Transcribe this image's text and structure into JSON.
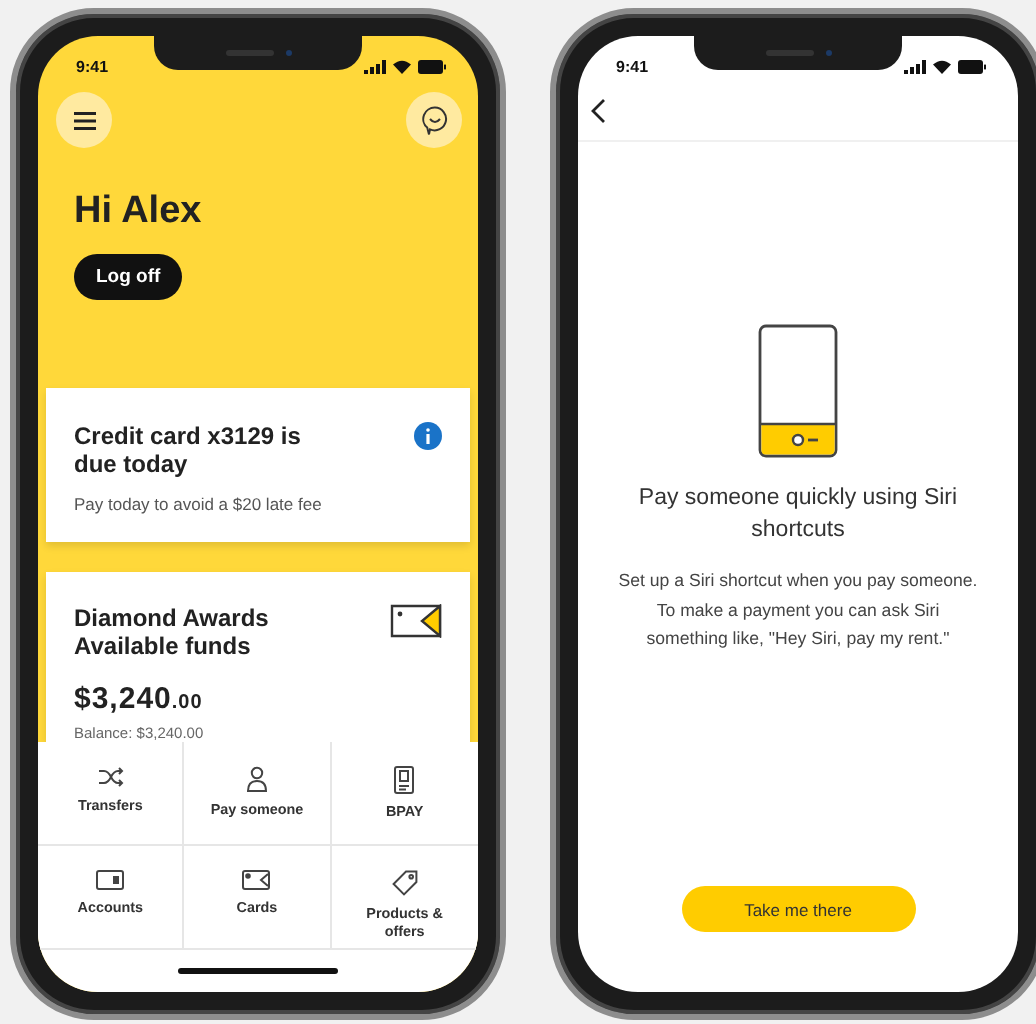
{
  "home_screen": {
    "status_time": "9:41",
    "greeting": "Hi Alex",
    "logoff_button": "Log off",
    "alert_card": {
      "title": "Credit card x3129 is due today",
      "text": "Pay today to avoid a $20 late fee"
    },
    "account_card": {
      "name": "Diamond Awards",
      "subtitle": "Available funds",
      "amount": "$3,240",
      "cents": ".00",
      "balance": "Balance: $3,240.00"
    },
    "actions": [
      {
        "kind": "transfers",
        "label": "Transfers"
      },
      {
        "kind": "pay",
        "label": "Pay someone"
      },
      {
        "kind": "bpay",
        "label": "BPAY"
      },
      {
        "kind": "accounts",
        "label": "Accounts"
      },
      {
        "kind": "cards",
        "label": "Cards"
      },
      {
        "kind": "products",
        "label": "Products & offers"
      }
    ]
  },
  "siri_screen": {
    "status_time": "9:41",
    "title": "Pay someone quickly using Siri shortcuts",
    "text": "Set up a Siri shortcut when you pay someone. To make a payment you can ask Siri something like, \"Hey Siri, pay my rent.\"",
    "button": "Take me there"
  }
}
